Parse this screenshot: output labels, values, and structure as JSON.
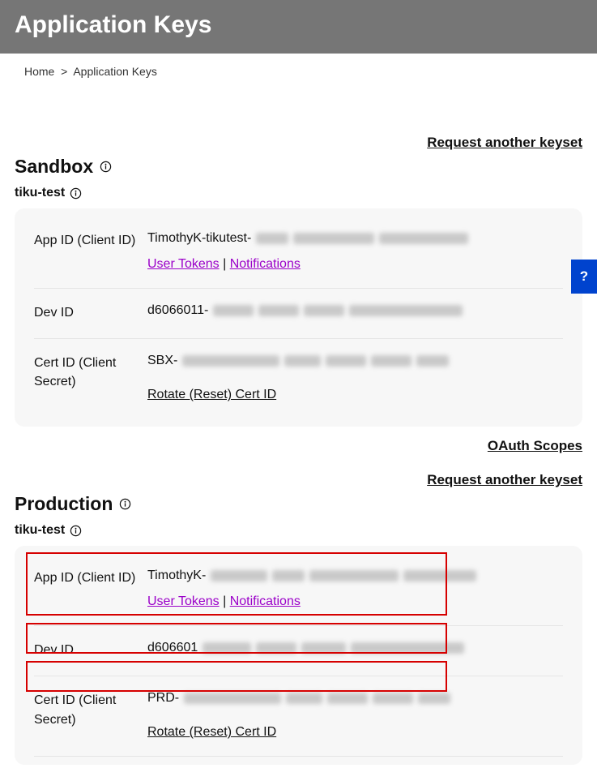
{
  "header": {
    "title": "Application Keys"
  },
  "breadcrumb": {
    "home": "Home",
    "sep": ">",
    "current": "Application Keys"
  },
  "links": {
    "request_keyset": "Request another keyset",
    "oauth_scopes": "OAuth Scopes",
    "user_tokens": "User Tokens",
    "notifications": "Notifications",
    "rotate_cert": "Rotate (Reset) Cert ID",
    "sep": " | "
  },
  "labels": {
    "app_id": "App ID (Client ID)",
    "dev_id": "Dev ID",
    "cert_id": "Cert ID (Client Secret)"
  },
  "sandbox": {
    "title": "Sandbox",
    "app_name": "tiku-test",
    "app_id_prefix": "TimothyK-tikutest-",
    "dev_id_prefix": "d6066011-",
    "cert_id_prefix": "SBX-"
  },
  "production": {
    "title": "Production",
    "app_name": "tiku-test",
    "app_id_prefix": "TimothyK-",
    "dev_id_prefix": "d606601",
    "cert_id_prefix": "PRD-"
  },
  "help": {
    "glyph": "?"
  }
}
